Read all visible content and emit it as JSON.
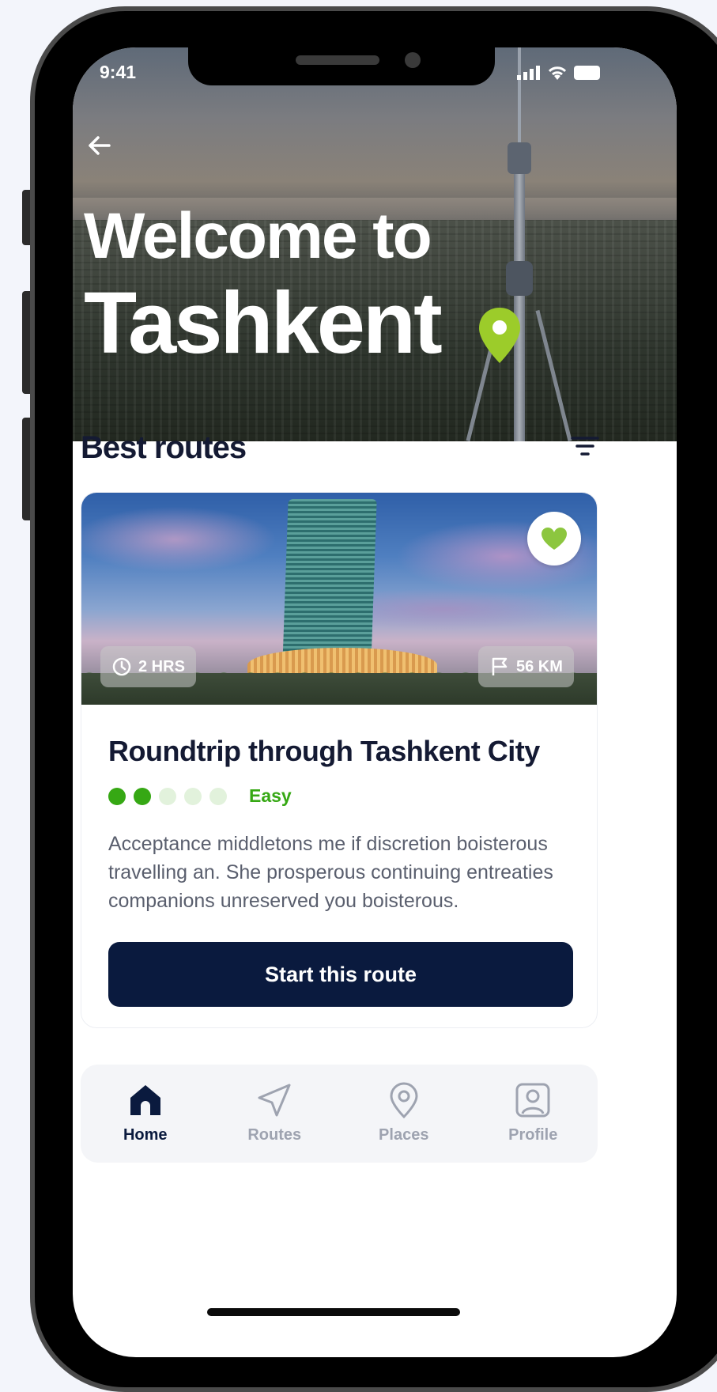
{
  "status": {
    "time": "9:41"
  },
  "hero": {
    "line1": "Welcome to",
    "line2": "Tashkent"
  },
  "section": {
    "title": "Best routes"
  },
  "route_card": {
    "duration": "2 HRS",
    "distance": "56 KM",
    "title": "Roundtrip through Tashkent City",
    "difficulty": {
      "level": 2,
      "max": 5,
      "label": "Easy"
    },
    "description": "Acceptance middletons me if discretion boisterous travelling an. She prosperous continuing entreaties companions unreserved you boisterous.",
    "cta": "Start this route"
  },
  "nav": {
    "items": [
      {
        "label": "Home",
        "icon": "home-icon",
        "active": true
      },
      {
        "label": "Routes",
        "icon": "navigation-icon",
        "active": false
      },
      {
        "label": "Places",
        "icon": "map-pin-icon",
        "active": false
      },
      {
        "label": "Profile",
        "icon": "profile-icon",
        "active": false
      }
    ]
  },
  "colors": {
    "accent": "#36a814",
    "primary": "#0a1a3e",
    "pin": "#9ccc2a",
    "heart": "#8cc63f"
  }
}
